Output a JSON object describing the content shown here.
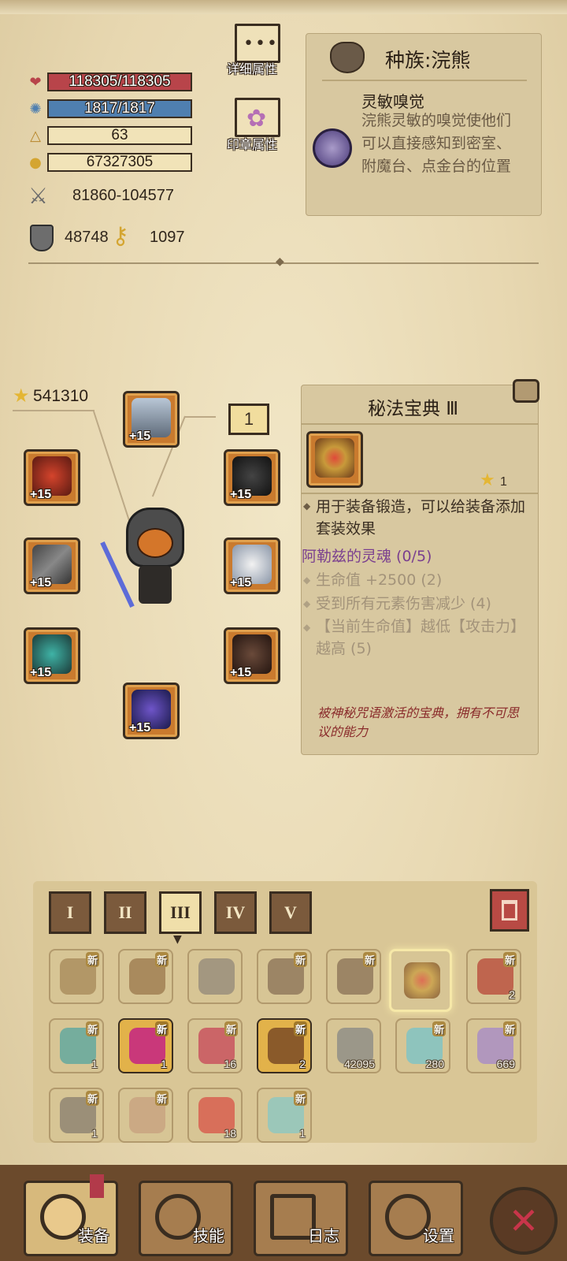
{
  "stats": {
    "hp": "118305/118305",
    "mp": "1817/1817",
    "level": "63",
    "gold": "67327305",
    "attack": "81860-104577",
    "defense": "48748",
    "other": "1097"
  },
  "menu": {
    "detail_label": "详细属性",
    "seal_label": "印章属性"
  },
  "race": {
    "title": "种族:浣熊",
    "trait_name": "灵敏嗅觉",
    "trait_desc": "浣熊灵敏的嗅觉使他们可以直接感知到密室、附魔台、点金台的位置"
  },
  "equipment": {
    "score": "541310",
    "badge_number": "1",
    "plus": "+15"
  },
  "item": {
    "name": "秘法宝典 Ⅲ",
    "stars": "1",
    "desc": "用于装备锻造，可以给装备添加套装效果",
    "set_name": "阿勒兹的灵魂 (0/5)",
    "set_effects": [
      "生命值 +2500 (2)",
      "受到所有元素伤害减少 (4)",
      "【当前生命值】越低【攻击力】越高 (5)"
    ],
    "flavor": "被神秘咒语激活的宝典，拥有不可思议的能力"
  },
  "tabs": [
    "I",
    "II",
    "III",
    "IV",
    "V"
  ],
  "inventory": {
    "new_label": "新",
    "row3_counts": [
      "1",
      "1",
      "16",
      "2",
      "42095",
      "280",
      "669"
    ],
    "row4_counts": [
      "1",
      "",
      "18",
      "1"
    ],
    "row2_last_count": "2"
  },
  "nav": {
    "equip": "装备",
    "skill": "技能",
    "log": "日志",
    "settings": "设置"
  },
  "colors": {
    "hp": "#b8444a",
    "mp": "#4f7fb0",
    "set_name": "#7a3f8f",
    "flavor": "#8a2b2b"
  }
}
